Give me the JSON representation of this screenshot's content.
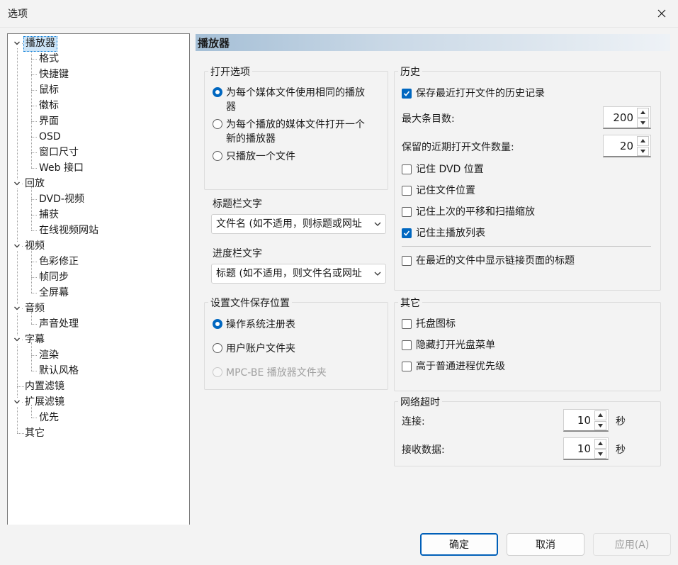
{
  "window": {
    "title": "选项"
  },
  "tree": [
    {
      "label": "播放器",
      "level": 0,
      "expandable": true,
      "selected": true
    },
    {
      "label": "格式",
      "level": 1
    },
    {
      "label": "快捷键",
      "level": 1
    },
    {
      "label": "鼠标",
      "level": 1
    },
    {
      "label": "徽标",
      "level": 1
    },
    {
      "label": "界面",
      "level": 1
    },
    {
      "label": "OSD",
      "level": 1
    },
    {
      "label": "窗口尺寸",
      "level": 1
    },
    {
      "label": "Web 接口",
      "level": 1
    },
    {
      "label": "回放",
      "level": 0,
      "expandable": true
    },
    {
      "label": "DVD-视频",
      "level": 1
    },
    {
      "label": "捕获",
      "level": 1
    },
    {
      "label": "在线视频网站",
      "level": 1
    },
    {
      "label": "视频",
      "level": 0,
      "expandable": true
    },
    {
      "label": "色彩修正",
      "level": 1
    },
    {
      "label": "帧同步",
      "level": 1
    },
    {
      "label": "全屏幕",
      "level": 1
    },
    {
      "label": "音频",
      "level": 0,
      "expandable": true
    },
    {
      "label": "声音处理",
      "level": 1
    },
    {
      "label": "字幕",
      "level": 0,
      "expandable": true
    },
    {
      "label": "渲染",
      "level": 1
    },
    {
      "label": "默认风格",
      "level": 1
    },
    {
      "label": "内置滤镜",
      "level": 0,
      "expandable": false
    },
    {
      "label": "扩展滤镜",
      "level": 0,
      "expandable": true
    },
    {
      "label": "优先",
      "level": 1
    },
    {
      "label": "其它",
      "level": 0,
      "expandable": false
    }
  ],
  "page": {
    "header": "播放器"
  },
  "open_options": {
    "title": "打开选项",
    "radio1_line1": "为每个媒体文件使用相同的播放",
    "radio1_line2": "器",
    "radio2_line1": "为每个播放的媒体文件打开一个",
    "radio2_line2": "新的播放器",
    "radio3": "只播放一个文件"
  },
  "title_bar_text": {
    "label": "标题栏文字",
    "value": "文件名 (如不适用，则标题或网址"
  },
  "seekbar_text": {
    "label": "进度栏文字",
    "value": "标题 (如不适用，则文件名或网址"
  },
  "save_location": {
    "title": "设置文件保存位置",
    "option1": "操作系统注册表",
    "option2": "用户账户文件夹",
    "option3": "MPC-BE 播放器文件夹"
  },
  "history": {
    "title": "历史",
    "keep_history": "保存最近打开文件的历史记录",
    "max_items_label": "最大条目数:",
    "max_items": "200",
    "recent_files_label": "保留的近期打开文件数量:",
    "recent_files": "20",
    "remember_dvd": "记住 DVD 位置",
    "remember_file": "记住文件位置",
    "remember_pan": "记住上次的平移和扫描缩放",
    "remember_playlist": "记住主播放列表",
    "show_link_title": "在最近的文件中显示链接页面的标题"
  },
  "other": {
    "title": "其它",
    "tray_icon": "托盘图标",
    "hide_cd_menu": "隐藏打开光盘菜单",
    "high_priority": "高于普通进程优先级"
  },
  "network": {
    "title": "网络超时",
    "connect_label": "连接:",
    "connect_value": "10",
    "receive_label": "接收数据:",
    "receive_value": "10",
    "unit": "秒"
  },
  "buttons": {
    "ok": "确定",
    "cancel": "取消",
    "apply": "应用(A)"
  },
  "colors": {
    "accent": "#0067c0",
    "header_gradient_start": "#a5bfd6"
  }
}
